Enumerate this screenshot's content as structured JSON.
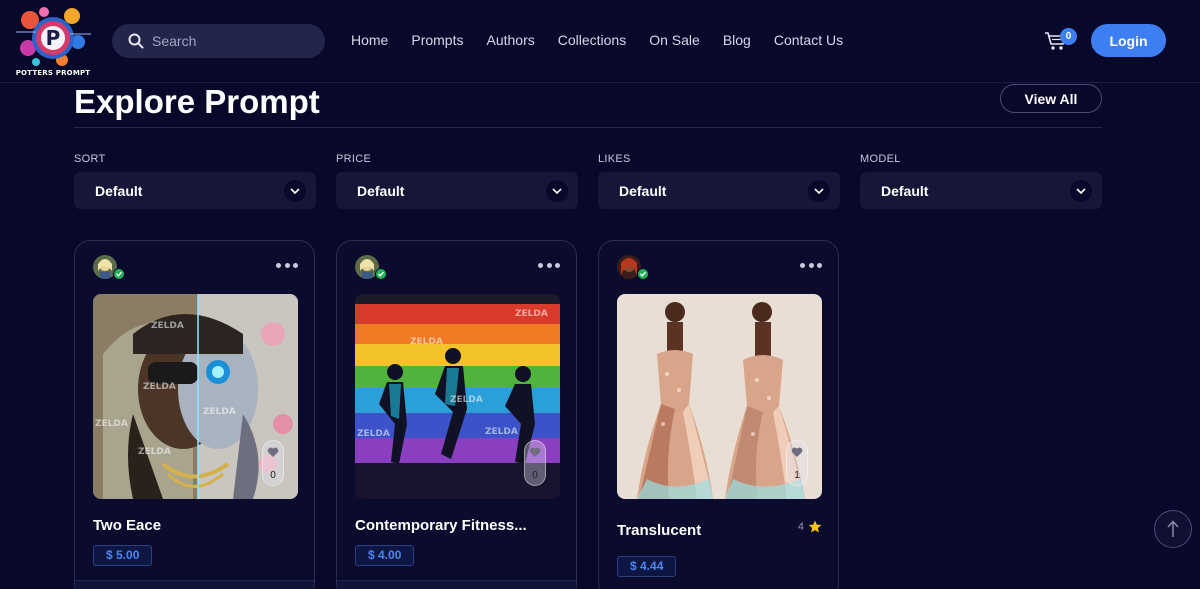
{
  "brand": {
    "logo_text": "POTTERS PROMPT"
  },
  "search": {
    "placeholder": "Search"
  },
  "nav": [
    "Home",
    "Prompts",
    "Authors",
    "Collections",
    "On Sale",
    "Blog",
    "Contact Us"
  ],
  "cart": {
    "count": "0"
  },
  "auth": {
    "login_label": "Login"
  },
  "main": {
    "title": "Explore Prompt",
    "view_all_label": "View All"
  },
  "filters": [
    {
      "label": "SORT",
      "value": "Default"
    },
    {
      "label": "PRICE",
      "value": "Default"
    },
    {
      "label": "LIKES",
      "value": "Default"
    },
    {
      "label": "MODEL",
      "value": "Default"
    }
  ],
  "cards": [
    {
      "title": "Two Eace",
      "price": "$ 5.00",
      "likes": "0",
      "watermark": "ZELDA"
    },
    {
      "title": "Contemporary Fitness...",
      "price": "$ 4.00",
      "likes": "0",
      "watermark": "ZELDA"
    },
    {
      "title": "Translucent",
      "price": "$ 4.44",
      "likes": "1",
      "rating": "4"
    }
  ],
  "colors": {
    "background": "#08082a",
    "accent": "#3d7ff2",
    "verified": "#21b25a",
    "star": "#f5c518"
  },
  "icons": [
    "search-icon",
    "cart-icon",
    "chevron-down-icon",
    "more-icon",
    "heart-icon",
    "star-icon",
    "arrow-up-icon",
    "verified-icon"
  ]
}
